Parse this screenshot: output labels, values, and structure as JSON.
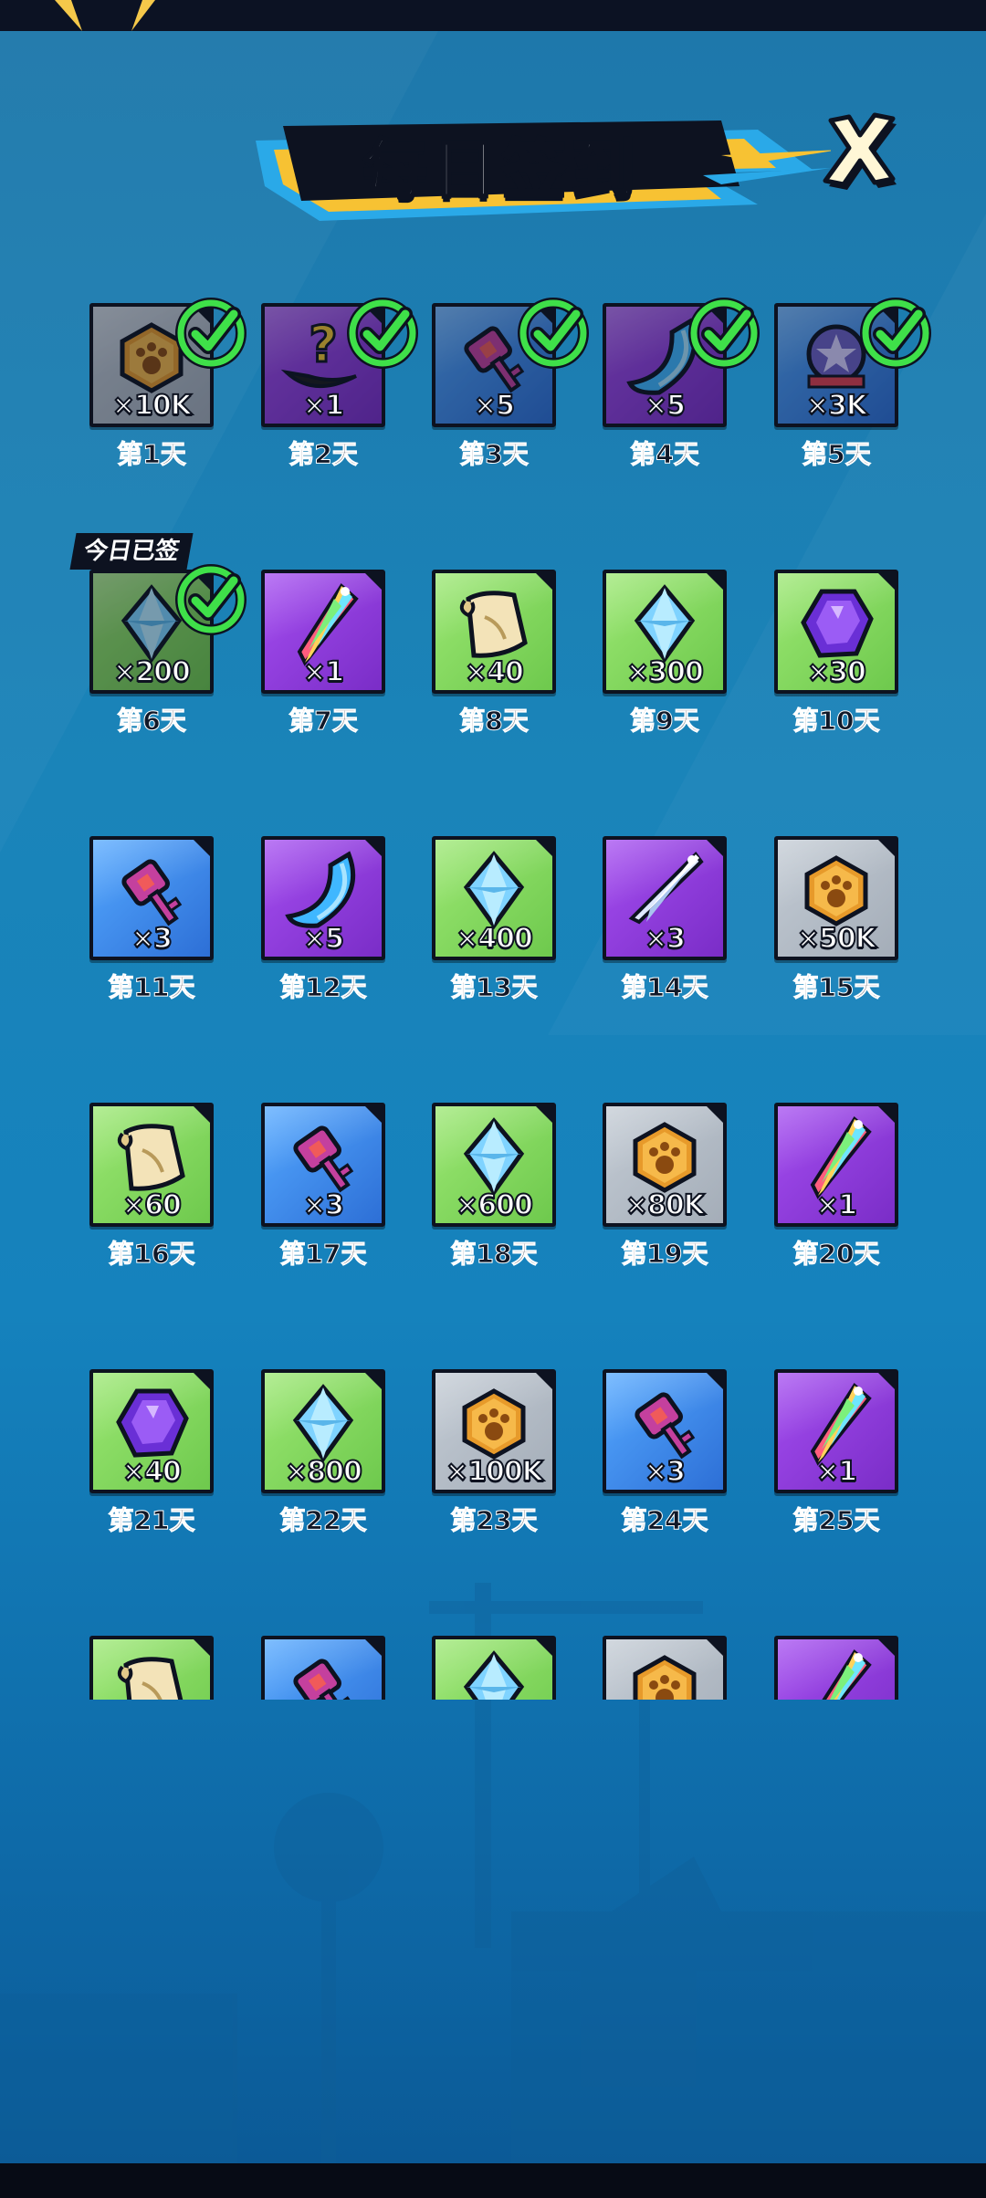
{
  "title": "每日签到",
  "today_badge": "今日已签",
  "colors": {
    "gray": "#a9b2bd",
    "purple": "#8f3ad9",
    "green": "#79d25a",
    "blue": "#3b86e8",
    "check": "#3fe049",
    "key_pink": "#c4409e",
    "coin": "#e79a2a"
  },
  "rows": [
    [
      {
        "day": "第1天",
        "qty": "×10K",
        "item": "paw-coin-icon",
        "bg": "gray",
        "claimed": true
      },
      {
        "day": "第2天",
        "qty": "×1",
        "item": "mystery-scythe-icon",
        "bg": "purple",
        "claimed": true
      },
      {
        "day": "第3天",
        "qty": "×5",
        "item": "key-icon",
        "bg": "blue",
        "claimed": true
      },
      {
        "day": "第4天",
        "qty": "×5",
        "item": "blade-shard-icon",
        "bg": "purple",
        "claimed": true
      },
      {
        "day": "第5天",
        "qty": "×3K",
        "item": "star-badge-icon",
        "bg": "blue",
        "claimed": true
      }
    ],
    [
      {
        "day": "第6天",
        "qty": "×200",
        "item": "diamond-icon",
        "bg": "green",
        "claimed": true,
        "today": true
      },
      {
        "day": "第7天",
        "qty": "×1",
        "item": "rainbow-crystal-icon",
        "bg": "purple",
        "claimed": false
      },
      {
        "day": "第8天",
        "qty": "×40",
        "item": "scroll-icon",
        "bg": "green",
        "claimed": false
      },
      {
        "day": "第9天",
        "qty": "×300",
        "item": "diamond-icon",
        "bg": "green",
        "claimed": false
      },
      {
        "day": "第10天",
        "qty": "×30",
        "item": "purple-gem-icon",
        "bg": "green",
        "claimed": false
      }
    ],
    [
      {
        "day": "第11天",
        "qty": "×3",
        "item": "key-icon",
        "bg": "blue",
        "claimed": false
      },
      {
        "day": "第12天",
        "qty": "×5",
        "item": "blade-shard-icon",
        "bg": "purple",
        "claimed": false
      },
      {
        "day": "第13天",
        "qty": "×400",
        "item": "diamond-icon",
        "bg": "green",
        "claimed": false
      },
      {
        "day": "第14天",
        "qty": "×3",
        "item": "silver-crystal-icon",
        "bg": "purple",
        "claimed": false
      },
      {
        "day": "第15天",
        "qty": "×50K",
        "item": "paw-coin-icon",
        "bg": "gray",
        "claimed": false
      }
    ],
    [
      {
        "day": "第16天",
        "qty": "×60",
        "item": "scroll-icon",
        "bg": "green",
        "claimed": false
      },
      {
        "day": "第17天",
        "qty": "×3",
        "item": "key-icon",
        "bg": "blue",
        "claimed": false
      },
      {
        "day": "第18天",
        "qty": "×600",
        "item": "diamond-icon",
        "bg": "green",
        "claimed": false
      },
      {
        "day": "第19天",
        "qty": "×80K",
        "item": "paw-coin-icon",
        "bg": "gray",
        "claimed": false
      },
      {
        "day": "第20天",
        "qty": "×1",
        "item": "rainbow-crystal-icon",
        "bg": "purple",
        "claimed": false
      }
    ],
    [
      {
        "day": "第21天",
        "qty": "×40",
        "item": "purple-gem-icon",
        "bg": "green",
        "claimed": false
      },
      {
        "day": "第22天",
        "qty": "×800",
        "item": "diamond-icon",
        "bg": "green",
        "claimed": false
      },
      {
        "day": "第23天",
        "qty": "×100K",
        "item": "paw-coin-icon",
        "bg": "gray",
        "claimed": false
      },
      {
        "day": "第24天",
        "qty": "×3",
        "item": "key-icon",
        "bg": "blue",
        "claimed": false
      },
      {
        "day": "第25天",
        "qty": "×1",
        "item": "rainbow-crystal-icon",
        "bg": "purple",
        "claimed": false
      }
    ],
    [
      {
        "day": "",
        "qty": "",
        "item": "scroll-icon",
        "bg": "green",
        "claimed": false
      },
      {
        "day": "",
        "qty": "",
        "item": "key-icon",
        "bg": "blue",
        "claimed": false
      },
      {
        "day": "",
        "qty": "",
        "item": "diamond-icon",
        "bg": "green",
        "claimed": false
      },
      {
        "day": "",
        "qty": "",
        "item": "paw-coin-icon",
        "bg": "gray",
        "claimed": false
      },
      {
        "day": "",
        "qty": "",
        "item": "rainbow-crystal-icon",
        "bg": "purple",
        "claimed": false
      }
    ]
  ]
}
